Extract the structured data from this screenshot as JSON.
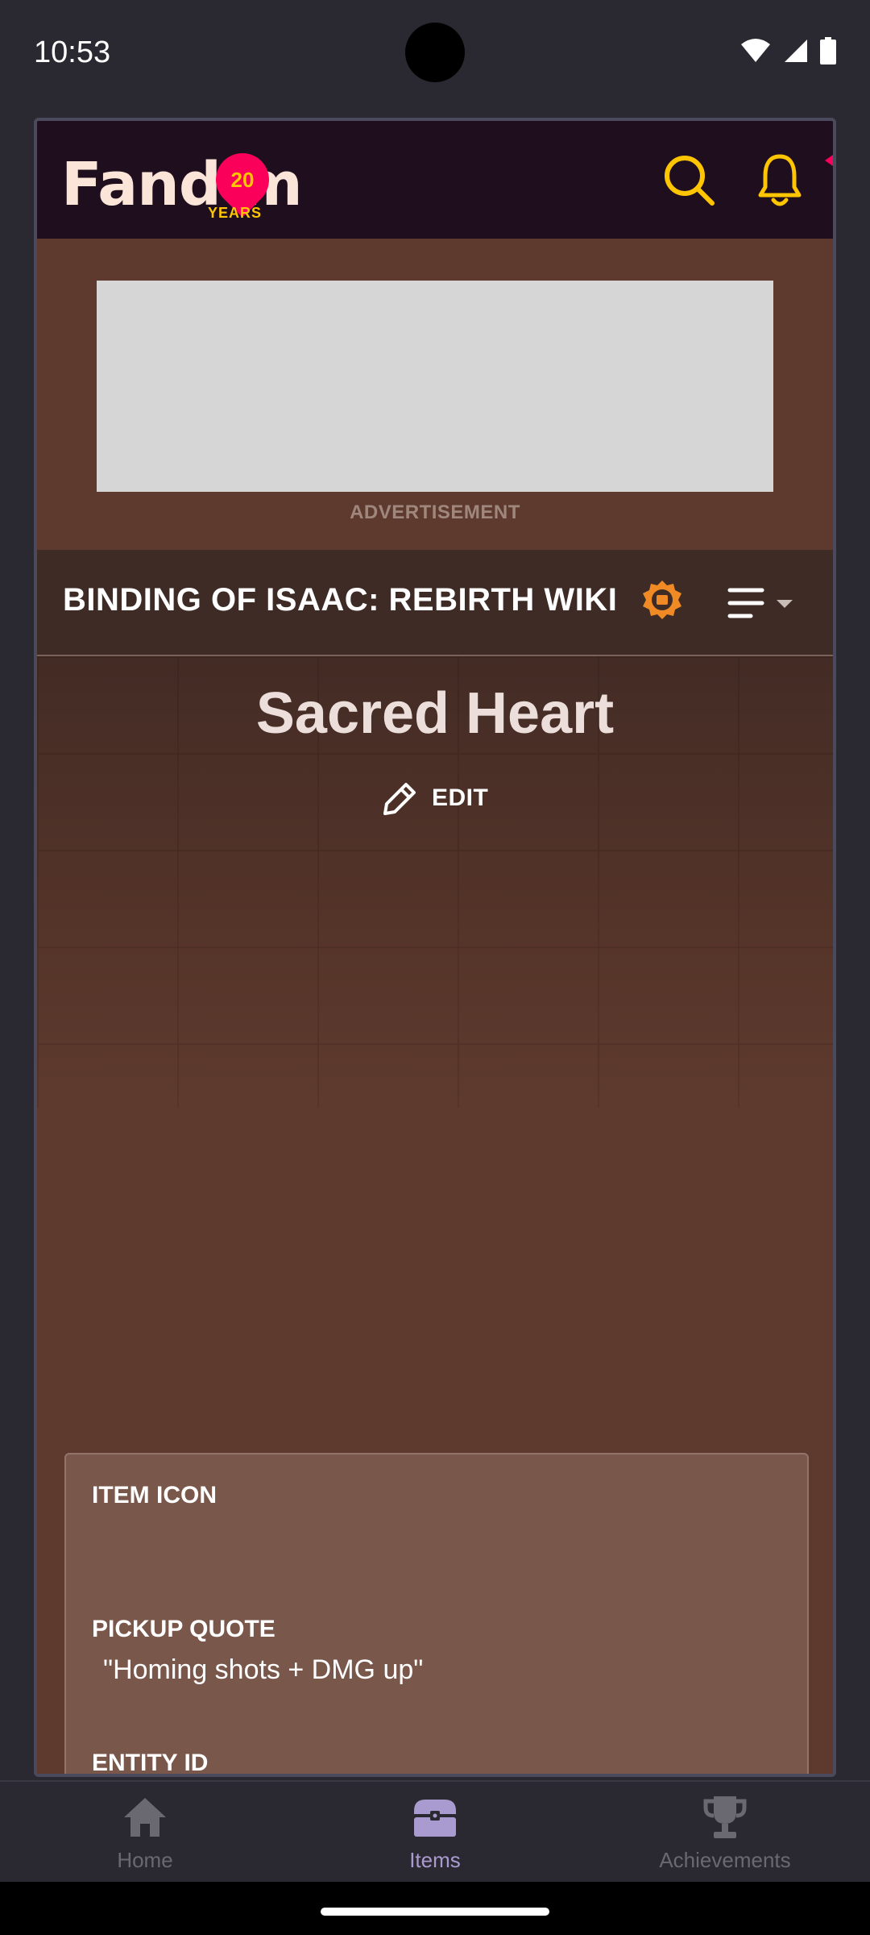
{
  "status_bar": {
    "time": "10:53"
  },
  "header": {
    "logo_text": "Fand  m",
    "logo_badge_number": "20",
    "logo_years": "YEARS",
    "search_icon": "search-icon",
    "notification_icon": "bell-icon"
  },
  "advertisement": {
    "label": "ADVERTISEMENT"
  },
  "wiki": {
    "name": "BINDING OF ISAAC: REBIRTH WIKI",
    "badge_icon": "wiki-badge-icon",
    "menu_icon": "menu-icon"
  },
  "page": {
    "title": "Sacred Heart",
    "edit_label": "EDIT"
  },
  "infobox": {
    "item_icon_label": "ITEM ICON",
    "pickup_quote_label": "PICKUP QUOTE",
    "pickup_quote_value": "\"Homing shots + DMG up\"",
    "entity_id_label": "ENTITY ID"
  },
  "bottom_nav": {
    "items": [
      {
        "label": "Home",
        "icon": "home-icon",
        "active": false
      },
      {
        "label": "Items",
        "icon": "chest-icon",
        "active": true
      },
      {
        "label": "Achievements",
        "icon": "trophy-icon",
        "active": false
      }
    ]
  },
  "colors": {
    "background": "#2a2830",
    "fandom_header": "#1f0f1e",
    "wiki_page_bg": "#5e3a2e",
    "wiki_bar": "#3e2b26",
    "infobox": "#7a574b",
    "accent_yellow": "#ffc500",
    "accent_pink": "#fa005a",
    "nav_active": "#a99bd0",
    "nav_inactive": "#6a6870"
  }
}
